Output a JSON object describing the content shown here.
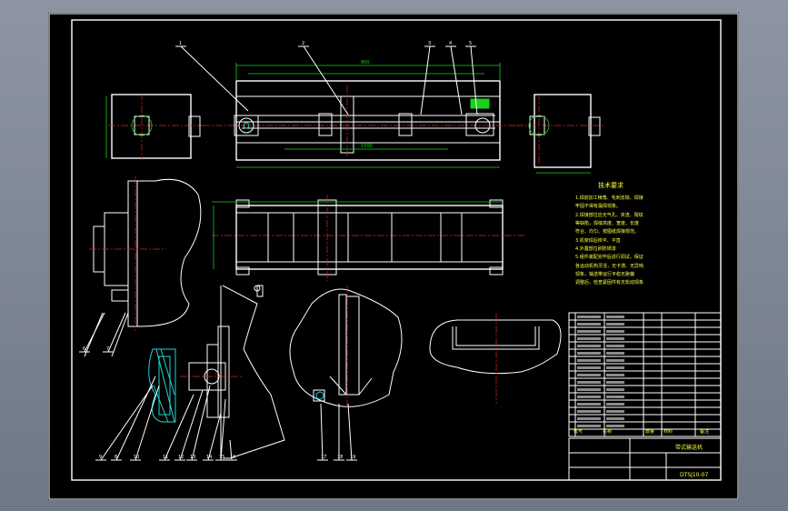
{
  "drawing": {
    "part_labels": [
      "1",
      "2",
      "3",
      "4",
      "5",
      "6",
      "7",
      "8",
      "9",
      "10",
      "11",
      "12",
      "13",
      "14",
      "15",
      "16",
      "17",
      "18",
      "19"
    ],
    "notes_title": "技术要求",
    "notes": [
      "1.焊前加工棱角、毛刺去除、焊接",
      "牢固不得有漏焊现象。",
      "2.焊接部位应无气孔、夹渣、裂纹",
      "等缺陷，焊缝高度、宽度、长度",
      "符合、均匀、按图纸焊接规范。",
      "3.机架焊后校平、平直",
      "4.外露部位刷防锈漆",
      "5.组件装配完毕后进行调试，保证",
      "各运动机构灵活，无卡滞、无异响",
      "现象，输送带运行平稳无跑偏",
      "调整后，检查紧固件有无松动现象"
    ],
    "title_block": {
      "drawing_title": "带式输送机",
      "drawing_number": "DTSJ10-07",
      "material_header": "材料",
      "qty_header": "数量",
      "code_header": "代号",
      "name_header": "名称",
      "remark_header": "备注"
    },
    "colors": {
      "sheet": "#000000",
      "line": "#ffffff",
      "dimension": "#19d11e",
      "centerline": "#e02020",
      "hatch": "#21d6d6",
      "text": "#ffff40"
    }
  }
}
